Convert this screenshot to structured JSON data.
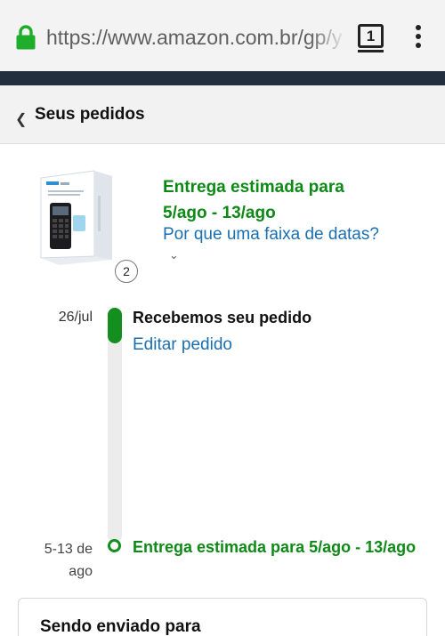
{
  "browser": {
    "url": "https://www.amazon.com.br/gp/y",
    "tab_count": "1",
    "lock_color": "#1fae2b"
  },
  "header": {
    "title": "Seus pedidos",
    "back_icon": "chevron-left-icon"
  },
  "order": {
    "quantity": "2",
    "estimate_line1": "Entrega estimada para",
    "estimate_line2": "5/ago - 13/ago",
    "why_link": "Por que uma faixa de datas?",
    "expand_icon": "chevron-down-icon"
  },
  "timeline": {
    "progress_fraction": 0.15,
    "events": [
      {
        "date": "26/jul",
        "label": "Recebemos seu pedido",
        "action": "Editar pedido"
      },
      {
        "date": "5-13 de ago",
        "label": "Entrega estimada para 5/ago - 13/ago"
      }
    ]
  },
  "shipping": {
    "title": "Sendo enviado para"
  },
  "colors": {
    "green": "#0d8a16",
    "link_blue": "#1a6fb0",
    "amazon_nav": "#232f3e"
  }
}
